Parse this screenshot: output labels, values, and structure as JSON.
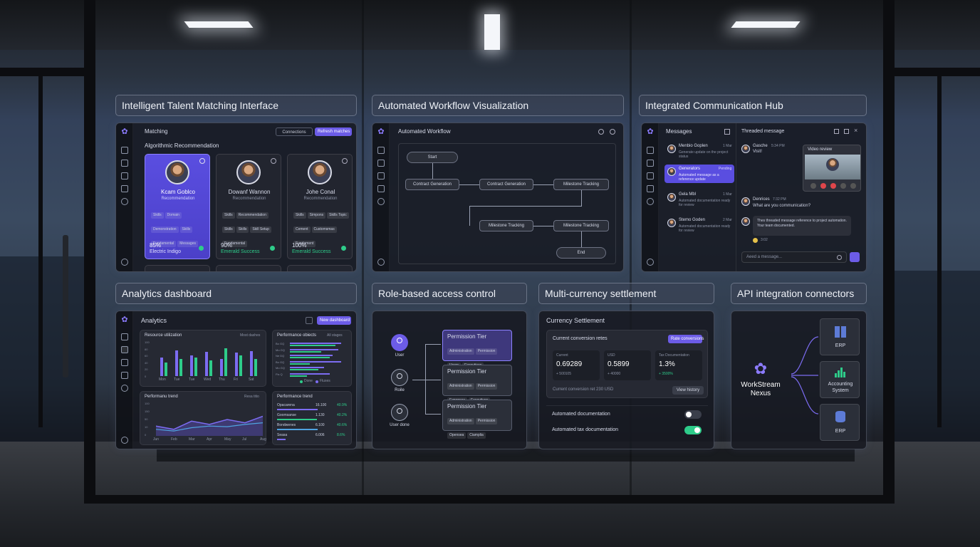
{
  "section_titles": {
    "talent": "Intelligent Talent Matching Interface",
    "workflow": "Automated Workflow Visualization",
    "comm": "Integrated Communication Hub",
    "analytics": "Analytics dashboard",
    "rbac": "Role-based access control",
    "currency": "Multi-currency settlement",
    "api": "API integration connectors"
  },
  "talent": {
    "title": "Matching",
    "btn_secondary": "Connections",
    "btn_primary": "Refresh matches",
    "subtitle": "Algorithmic Recommendation",
    "candidates": [
      {
        "name": "Kcam Goblco",
        "role": "Recommendation",
        "tags": [
          "Skills",
          "Domain",
          "Demonstration",
          "Skills",
          "Fundamental",
          "Messages"
        ],
        "score_pct": "85%",
        "score_label": "Electric Indigo"
      },
      {
        "name": "Dowanf Wannon",
        "role": "Recommendation",
        "tags": [
          "Skills",
          "Recommendation",
          "Skills",
          "Skills",
          "Skill Setup",
          "Fundamental"
        ],
        "score_pct": "90%",
        "score_label": "Emerald Success"
      },
      {
        "name": "Johe Conal",
        "role": "Recommendation",
        "tags": [
          "Skills",
          "Simpons",
          "Skills Topic",
          "Cement",
          "Customsmas",
          "Fundament"
        ],
        "score_pct": "100%",
        "score_label": "Emerald Success"
      }
    ]
  },
  "workflow": {
    "title": "Automated Workflow",
    "nodes": {
      "start": "Start",
      "n1": "Contract Generation",
      "n2": "Contract Generation",
      "n3": "Milestone Tracking",
      "n4": "Milestone Tracking",
      "n5": "Milestone Tracking",
      "end": "End"
    }
  },
  "comm": {
    "title": "Messages",
    "thread_title": "Threaded message",
    "messages": [
      {
        "name": "Menbio Goplen",
        "time": "1 Mar",
        "text": "Generate update on the project status"
      },
      {
        "name": "Generators",
        "time": "Pending",
        "text": "Automated message as a reference update"
      },
      {
        "name": "Gela Mbl",
        "time": "1 Mar",
        "text": "Automated documentation ready for review"
      },
      {
        "name": "Stemo Goden",
        "time": "2 Mar",
        "text": "Automated documentation ready for review"
      }
    ],
    "thread": [
      {
        "name": "Gasche",
        "time": "5:34 PM",
        "text": "Visit!"
      },
      {
        "name": "Denrices",
        "time": "7:32 PM",
        "text": "What are you communication?"
      },
      {
        "name": "",
        "time": "",
        "text": "Thes threaded message reference to project automation. Your team documented."
      }
    ],
    "reactions": "3:02",
    "video_title": "Video review",
    "input_placeholder": "Aeed a message..."
  },
  "analytics": {
    "title": "Analytics",
    "btn": "New dashboard",
    "resource": {
      "title": "Resource utilization",
      "filter": "Most dashes",
      "days": [
        "Mon",
        "Tue",
        "Tue",
        "Wed",
        "Thu",
        "Fri",
        "Sat"
      ],
      "ticks": [
        "100",
        "80",
        "60",
        "40",
        "20",
        "0"
      ],
      "purple": [
        0.55,
        0.75,
        0.6,
        0.7,
        0.5,
        0.68,
        0.72
      ],
      "green": [
        0.4,
        0.5,
        0.55,
        0.45,
        0.82,
        0.6,
        0.5
      ]
    },
    "perf_obj": {
      "title": "Performance obiects",
      "filter": "All stages",
      "rows": [
        "Bo GQ",
        "Mo GQ",
        "Ne DQ",
        "Bo GQ",
        "Mo GQ",
        "Fis Q"
      ],
      "legend": [
        "Done",
        "Fluxes"
      ],
      "green": [
        0.8,
        0.55,
        0.7,
        0.35,
        0.5,
        0.3
      ],
      "purple": [
        0.9,
        0.85,
        0.75,
        0.9,
        0.6,
        0.7
      ]
    },
    "trend": {
      "title": "Performanu trend",
      "filter": "Resa titio",
      "months": [
        "Jun",
        "Feb",
        "Mar",
        "Apr",
        "May",
        "Jul",
        "Aug"
      ],
      "ticks": [
        "100",
        "150",
        "50",
        "10",
        "0"
      ],
      "series1": [
        0.3,
        0.2,
        0.45,
        0.35,
        0.5,
        0.4,
        0.6
      ],
      "series2": [
        0.2,
        0.15,
        0.25,
        0.3,
        0.28,
        0.35,
        0.4
      ]
    },
    "trend2": {
      "title": "Performance trend",
      "rows": [
        {
          "label": "Opacarena",
          "val": "16.100",
          "pct": "40.9%"
        },
        {
          "label": "Goomsanse",
          "val": "1.130",
          "pct": "40.2%"
        },
        {
          "label": "Bondwenes",
          "val": "6.100",
          "pct": "40.6%"
        },
        {
          "label": "Seasa",
          "val": "6.006",
          "pct": "8.6%"
        }
      ]
    }
  },
  "rbac": {
    "roles": [
      "User",
      "Roile",
      "User done"
    ],
    "tiers": [
      {
        "title": "Permission Tier",
        "tags": [
          "Administration",
          "Permission",
          "Users",
          "Executives"
        ]
      },
      {
        "title": "Permission Tier",
        "tags": [
          "Administration",
          "Permission",
          "Expenses",
          "Executives"
        ]
      },
      {
        "title": "Permission Tier",
        "tags": [
          "Administration",
          "Permission",
          "Opensea",
          "Ciamplia"
        ]
      }
    ]
  },
  "currency": {
    "title": "Currency Settlement",
    "rates_label": "Current conversion retes",
    "rates_btn": "Rate conversions",
    "boxes": [
      {
        "label": "Current",
        "value": "0.69289",
        "delta": "+ 500105"
      },
      {
        "label": "USD",
        "value": "0.5899",
        "delta": "+ 40000"
      },
      {
        "label": "Tax Documentation",
        "value": "1.3%",
        "delta": "+ 3500%"
      }
    ],
    "foot_text": "Current conversion ret 230 USD",
    "foot_btn": "View history",
    "toggles": [
      {
        "label": "Automated documentation",
        "on": false
      },
      {
        "label": "Automated tax documentation",
        "on": true
      }
    ]
  },
  "api": {
    "hub_line1": "WorkStream",
    "hub_line2": "Nexus",
    "connectors": [
      {
        "label": "ERP",
        "icon": "grid-icon"
      },
      {
        "label": "Accounting System",
        "icon": "bar-chart-icon"
      },
      {
        "label": "ERP",
        "icon": "database-icon"
      }
    ]
  },
  "colors": {
    "accent": "#6c5ce7",
    "success": "#2ecc8a",
    "panel": "#161921"
  }
}
